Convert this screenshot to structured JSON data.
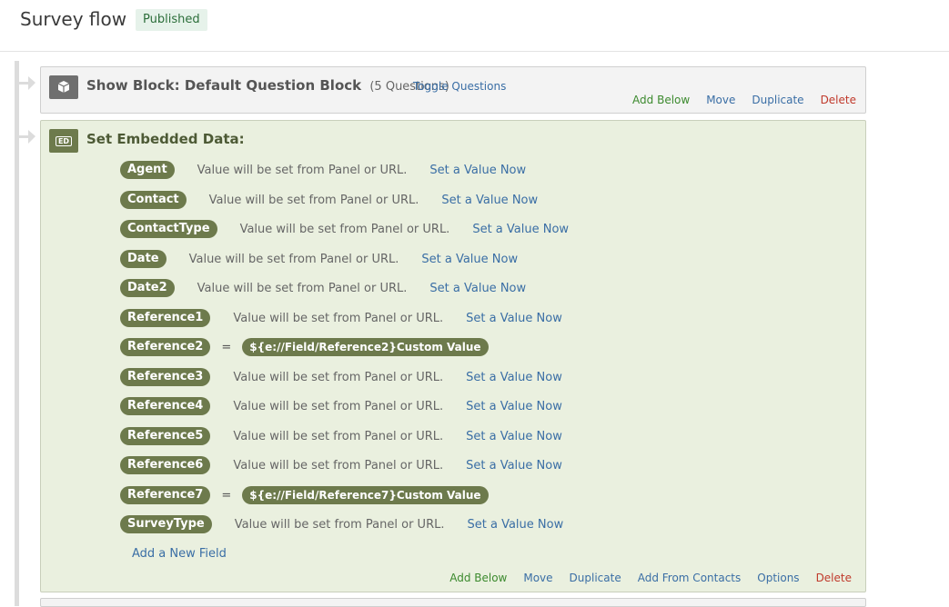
{
  "header": {
    "title": "Survey flow",
    "status": "Published"
  },
  "show_block": {
    "title": "Show Block: Default Question Block",
    "count": "(5 Questions)",
    "toggle": "Toggle Questions",
    "actions": {
      "add_below": "Add Below",
      "move": "Move",
      "duplicate": "Duplicate",
      "delete": "Delete"
    }
  },
  "embedded": {
    "title": "Set Embedded Data:",
    "rows": [
      {
        "field": "Agent",
        "desc": "Value will be set from Panel or URL.",
        "link": "Set a Value Now"
      },
      {
        "field": "Contact",
        "desc": "Value will be set from Panel or URL.",
        "link": "Set a Value Now"
      },
      {
        "field": "ContactType",
        "desc": "Value will be set from Panel or URL.",
        "link": "Set a Value Now"
      },
      {
        "field": "Date",
        "desc": "Value will be set from Panel or URL.",
        "link": "Set a Value Now"
      },
      {
        "field": "Date2",
        "desc": "Value will be set from Panel or URL.",
        "link": "Set a Value Now"
      },
      {
        "field": "Reference1",
        "desc": "Value will be set from Panel or URL.",
        "link": "Set a Value Now"
      },
      {
        "field": "Reference2",
        "eq": "=",
        "value": "${e://Field/Reference2}Custom Value"
      },
      {
        "field": "Reference3",
        "desc": "Value will be set from Panel or URL.",
        "link": "Set a Value Now"
      },
      {
        "field": "Reference4",
        "desc": "Value will be set from Panel or URL.",
        "link": "Set a Value Now"
      },
      {
        "field": "Reference5",
        "desc": "Value will be set from Panel or URL.",
        "link": "Set a Value Now"
      },
      {
        "field": "Reference6",
        "desc": "Value will be set from Panel or URL.",
        "link": "Set a Value Now"
      },
      {
        "field": "Reference7",
        "eq": "=",
        "value": "${e://Field/Reference7}Custom Value"
      },
      {
        "field": "SurveyType",
        "desc": "Value will be set from Panel or URL.",
        "link": "Set a Value Now"
      }
    ],
    "add_field": "Add a New Field",
    "actions": {
      "add_below": "Add Below",
      "move": "Move",
      "duplicate": "Duplicate",
      "add_from_contacts": "Add From Contacts",
      "options": "Options",
      "delete": "Delete"
    }
  }
}
